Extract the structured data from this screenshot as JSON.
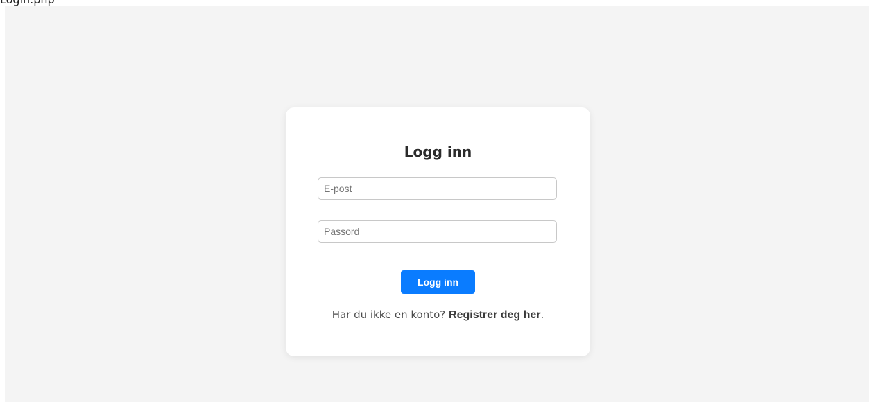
{
  "browser_tab_label": "Login.php",
  "login": {
    "title": "Logg inn",
    "email_placeholder": "E-post",
    "email_value": "",
    "password_placeholder": "Passord",
    "password_value": "",
    "submit_label": "Logg inn",
    "register_prompt": "Har du ikke en konto? ",
    "register_link": "Registrer deg her",
    "register_suffix": "."
  },
  "colors": {
    "page_background": "#f4f4f4",
    "card_background": "#ffffff",
    "accent": "#0a7cff"
  }
}
